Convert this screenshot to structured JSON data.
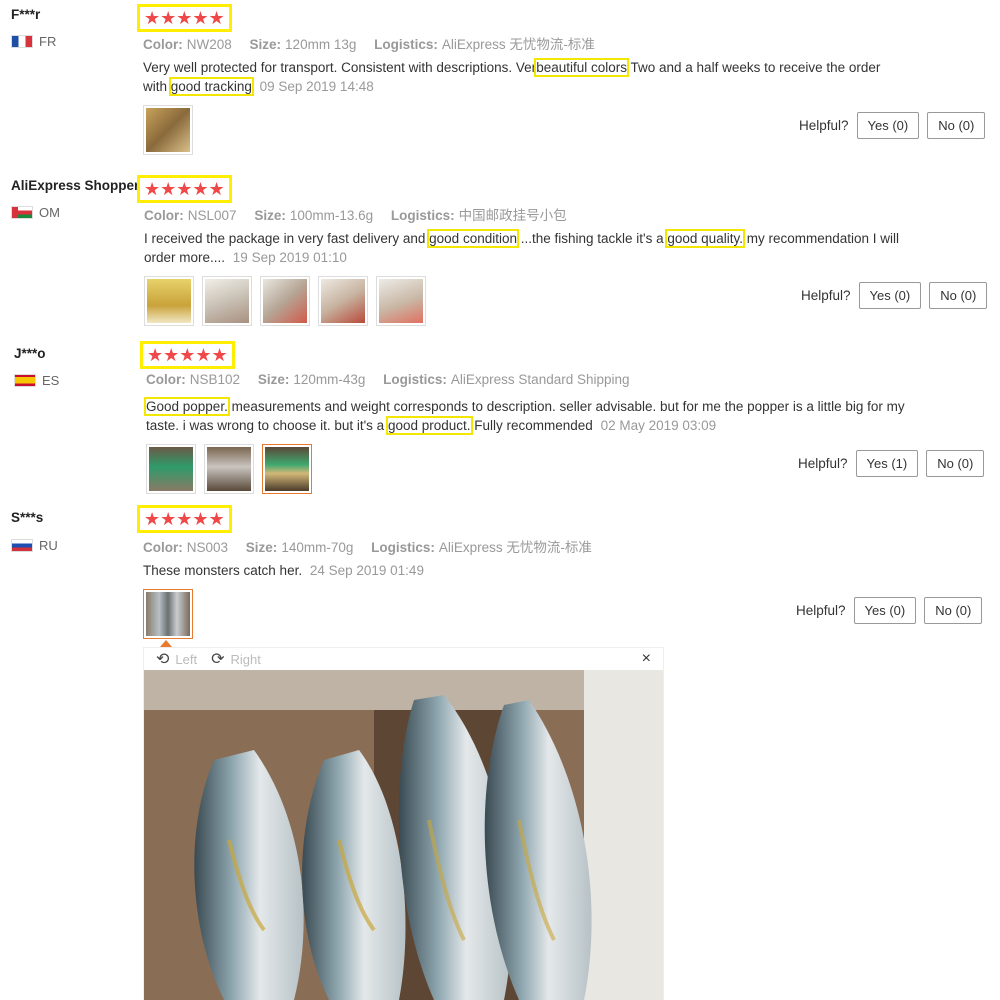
{
  "labels": {
    "color": "Color:",
    "size": "Size:",
    "logistics": "Logistics:",
    "helpful": "Helpful?"
  },
  "reviews": [
    {
      "user": "F***r",
      "country": "FR",
      "stars": "★★★★★",
      "color": "NW208",
      "size": "120mm 13g",
      "logistics": "AliExpress 无忧物流-标准",
      "text": [
        "Very well protected for transport. Consistent with descriptions. Ver",
        "beautiful colors",
        " Two and a half weeks to receive the order with",
        "good tracking",
        ""
      ],
      "date": "09 Sep 2019 14:48",
      "yes": "Yes (0)",
      "no": "No (0)"
    },
    {
      "user": "AliExpress Shopper",
      "country": "OM",
      "stars": "★★★★★",
      "color": "NSL007",
      "size": "100mm-13.6g",
      "logistics": "中国邮政挂号小包",
      "text": [
        "I received the package in very fast delivery and ",
        "good condition",
        " ...the fishing tackle it's a ",
        "good quality.",
        " my recommendation I will order more...."
      ],
      "date": "19 Sep 2019 01:10",
      "yes": "Yes (0)",
      "no": "No (0)"
    },
    {
      "user": "J***o",
      "country": "ES",
      "stars": "★★★★★",
      "color": "NSB102",
      "size": "120mm-43g",
      "logistics": "AliExpress Standard Shipping",
      "text": [
        "",
        "Good popper.",
        " measurements and weight corresponds to description. seller advisable. but for me the popper is a little big for my taste. i was wrong to choose it. but it's a ",
        "good product.",
        " Fully recommended"
      ],
      "date": "02 May 2019 03:09",
      "yes": "Yes (1)",
      "no": "No (0)"
    },
    {
      "user": "S***s",
      "country": "RU",
      "stars": "★★★★★",
      "color": "NS003",
      "size": "140mm-70g",
      "logistics": "AliExpress 无忧物流-标准",
      "text": [
        "These monsters catch her.",
        "",
        "",
        "",
        ""
      ],
      "date": "24 Sep 2019 01:49",
      "yes": "Yes (0)",
      "no": "No (0)"
    }
  ],
  "viewer": {
    "left": "Left",
    "right": "Right",
    "close": "×"
  }
}
